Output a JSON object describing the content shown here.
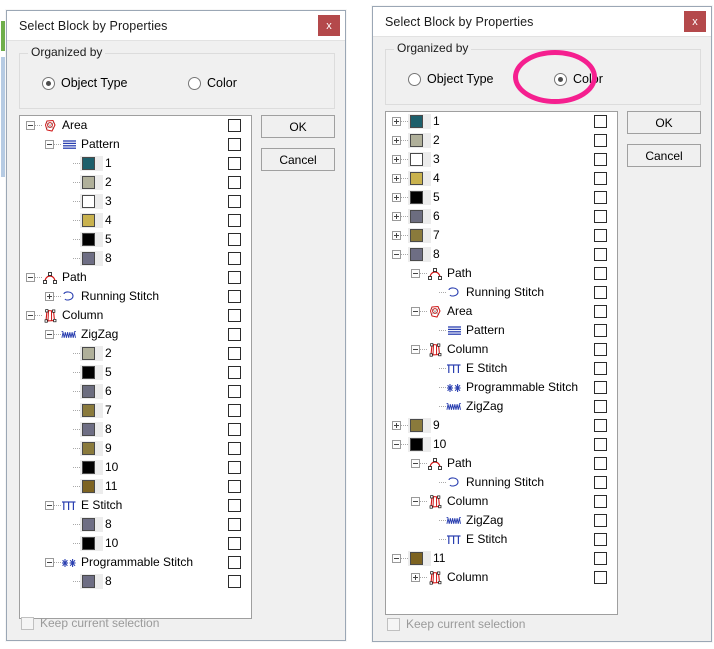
{
  "window": {
    "title": "Select Block by Properties",
    "close_label": "x",
    "close_icon": "close-icon"
  },
  "groupbox": {
    "legend": "Organized by",
    "options": [
      {
        "label": "Object Type",
        "value": "object_type"
      },
      {
        "label": "Color",
        "value": "color"
      }
    ]
  },
  "buttons": {
    "ok": "OK",
    "cancel": "Cancel"
  },
  "footer": {
    "keep_current_selection": "Keep current selection",
    "checked": false,
    "disabled": true
  },
  "annotation": {
    "shape": "ellipse",
    "color": "#f51f8f",
    "targets": "color-radio-option"
  },
  "palette": {
    "1": "#1d5f6b",
    "2": "#b0b09a",
    "3": "#ffffff",
    "4": "#c9b24e",
    "5": "#000000",
    "6": "#6c6d7f",
    "7": "#8a7a3c",
    "8": "#6e6e84",
    "9": "#8a7a3c",
    "10": "#000000",
    "11": "#7d6321"
  },
  "left_panel": {
    "selected_organize_mode": "object_type",
    "tree": [
      {
        "depth": 0,
        "expander": "minus",
        "icon": "area-icon",
        "label": "Area"
      },
      {
        "depth": 1,
        "expander": "minus",
        "icon": "pattern-icon",
        "label": "Pattern"
      },
      {
        "depth": 2,
        "expander": "none",
        "icon": "swatch",
        "color": "1",
        "label": "1"
      },
      {
        "depth": 2,
        "expander": "none",
        "icon": "swatch",
        "color": "2",
        "label": "2"
      },
      {
        "depth": 2,
        "expander": "none",
        "icon": "swatch",
        "color": "3",
        "label": "3"
      },
      {
        "depth": 2,
        "expander": "none",
        "icon": "swatch",
        "color": "4",
        "label": "4"
      },
      {
        "depth": 2,
        "expander": "none",
        "icon": "swatch",
        "color": "5",
        "label": "5"
      },
      {
        "depth": 2,
        "expander": "none",
        "icon": "swatch",
        "color": "8",
        "label": "8"
      },
      {
        "depth": 0,
        "expander": "minus",
        "icon": "path-icon",
        "label": "Path"
      },
      {
        "depth": 1,
        "expander": "plus",
        "icon": "running-stitch-icon",
        "label": "Running Stitch"
      },
      {
        "depth": 0,
        "expander": "minus",
        "icon": "column-icon",
        "label": "Column"
      },
      {
        "depth": 1,
        "expander": "minus",
        "icon": "zigzag-icon",
        "label": "ZigZag"
      },
      {
        "depth": 2,
        "expander": "none",
        "icon": "swatch",
        "color": "2",
        "label": "2"
      },
      {
        "depth": 2,
        "expander": "none",
        "icon": "swatch",
        "color": "5",
        "label": "5"
      },
      {
        "depth": 2,
        "expander": "none",
        "icon": "swatch",
        "color": "6",
        "label": "6"
      },
      {
        "depth": 2,
        "expander": "none",
        "icon": "swatch",
        "color": "7",
        "label": "7"
      },
      {
        "depth": 2,
        "expander": "none",
        "icon": "swatch",
        "color": "8",
        "label": "8"
      },
      {
        "depth": 2,
        "expander": "none",
        "icon": "swatch",
        "color": "9",
        "label": "9"
      },
      {
        "depth": 2,
        "expander": "none",
        "icon": "swatch",
        "color": "10",
        "label": "10"
      },
      {
        "depth": 2,
        "expander": "none",
        "icon": "swatch",
        "color": "11",
        "label": "11"
      },
      {
        "depth": 1,
        "expander": "minus",
        "icon": "estitch-icon",
        "label": "E Stitch"
      },
      {
        "depth": 2,
        "expander": "none",
        "icon": "swatch",
        "color": "8",
        "label": "8"
      },
      {
        "depth": 2,
        "expander": "none",
        "icon": "swatch",
        "color": "10",
        "label": "10"
      },
      {
        "depth": 1,
        "expander": "minus",
        "icon": "programmable-stitch-icon",
        "label": "Programmable Stitch"
      },
      {
        "depth": 2,
        "expander": "none",
        "icon": "swatch",
        "color": "8",
        "label": "8"
      }
    ]
  },
  "right_panel": {
    "selected_organize_mode": "color",
    "tree": [
      {
        "depth": 0,
        "expander": "plus",
        "icon": "swatch",
        "color": "1",
        "label": "1"
      },
      {
        "depth": 0,
        "expander": "plus",
        "icon": "swatch",
        "color": "2",
        "label": "2"
      },
      {
        "depth": 0,
        "expander": "plus",
        "icon": "swatch",
        "color": "3",
        "label": "3"
      },
      {
        "depth": 0,
        "expander": "plus",
        "icon": "swatch",
        "color": "4",
        "label": "4"
      },
      {
        "depth": 0,
        "expander": "plus",
        "icon": "swatch",
        "color": "5",
        "label": "5"
      },
      {
        "depth": 0,
        "expander": "plus",
        "icon": "swatch",
        "color": "6",
        "label": "6"
      },
      {
        "depth": 0,
        "expander": "plus",
        "icon": "swatch",
        "color": "7",
        "label": "7"
      },
      {
        "depth": 0,
        "expander": "minus",
        "icon": "swatch",
        "color": "8",
        "label": "8"
      },
      {
        "depth": 1,
        "expander": "minus",
        "icon": "path-icon",
        "label": "Path"
      },
      {
        "depth": 2,
        "expander": "none",
        "icon": "running-stitch-icon",
        "label": "Running Stitch"
      },
      {
        "depth": 1,
        "expander": "minus",
        "icon": "area-icon",
        "label": "Area"
      },
      {
        "depth": 2,
        "expander": "none",
        "icon": "pattern-icon",
        "label": "Pattern"
      },
      {
        "depth": 1,
        "expander": "minus",
        "icon": "column-icon",
        "label": "Column"
      },
      {
        "depth": 2,
        "expander": "none",
        "icon": "estitch-icon",
        "label": "E Stitch"
      },
      {
        "depth": 2,
        "expander": "none",
        "icon": "programmable-stitch-icon",
        "label": "Programmable Stitch"
      },
      {
        "depth": 2,
        "expander": "none",
        "icon": "zigzag-icon",
        "label": "ZigZag"
      },
      {
        "depth": 0,
        "expander": "plus",
        "icon": "swatch",
        "color": "9",
        "label": "9"
      },
      {
        "depth": 0,
        "expander": "minus",
        "icon": "swatch",
        "color": "10",
        "label": "10"
      },
      {
        "depth": 1,
        "expander": "minus",
        "icon": "path-icon",
        "label": "Path"
      },
      {
        "depth": 2,
        "expander": "none",
        "icon": "running-stitch-icon",
        "label": "Running Stitch"
      },
      {
        "depth": 1,
        "expander": "minus",
        "icon": "column-icon",
        "label": "Column"
      },
      {
        "depth": 2,
        "expander": "none",
        "icon": "zigzag-icon",
        "label": "ZigZag"
      },
      {
        "depth": 2,
        "expander": "none",
        "icon": "estitch-icon",
        "label": "E Stitch"
      },
      {
        "depth": 0,
        "expander": "minus",
        "icon": "swatch",
        "color": "11",
        "label": "11"
      },
      {
        "depth": 1,
        "expander": "plus",
        "icon": "column-icon",
        "label": "Column"
      }
    ]
  }
}
